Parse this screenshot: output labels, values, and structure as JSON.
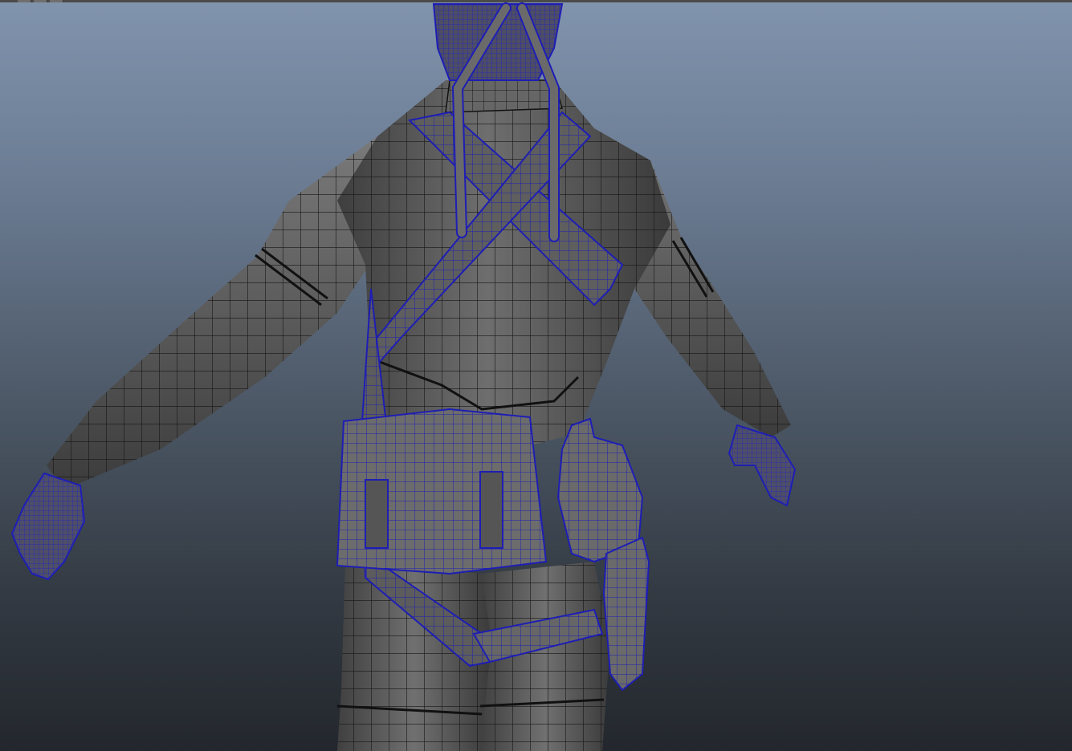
{
  "viewport": {
    "background_top": "#8194ad",
    "background_bottom": "#23272d"
  },
  "model": {
    "mesh_fill": "#5a5a5a",
    "mesh_fill_light": "#767676",
    "edge_color": "#141414",
    "selected_edge_color": "#1e1eb4"
  },
  "top_strip": {
    "buttons": [
      "strip-button",
      "strip-button",
      "strip-button"
    ]
  }
}
